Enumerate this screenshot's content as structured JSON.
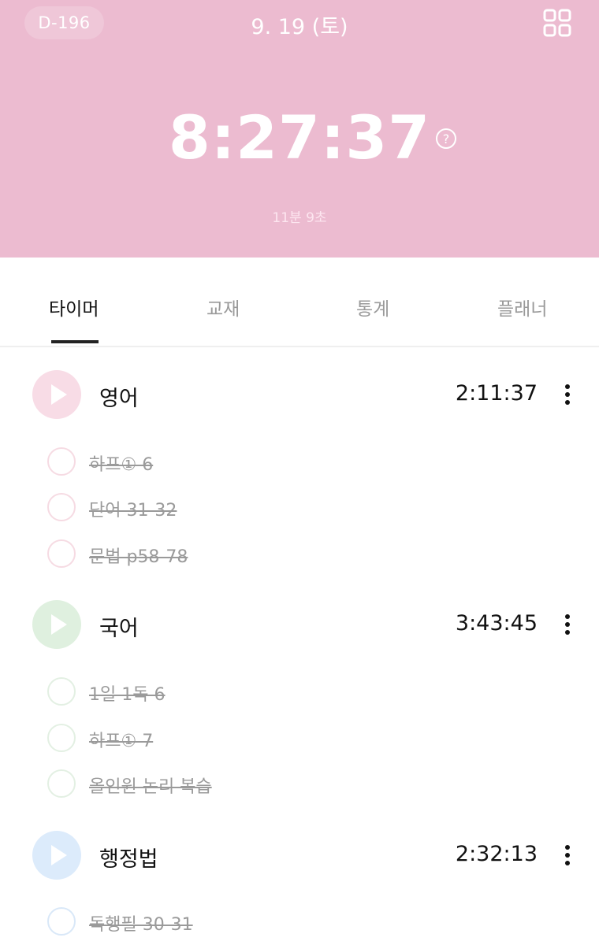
{
  "header": {
    "dday": "D-196",
    "date": "9. 19 (토)",
    "total_time": "8:27:37",
    "sub_time": "11분 9초",
    "background_color": "#ecbbd0"
  },
  "tabs": [
    {
      "label": "타이머",
      "active": true
    },
    {
      "label": "교재",
      "active": false
    },
    {
      "label": "통계",
      "active": false
    },
    {
      "label": "플래너",
      "active": false
    }
  ],
  "subjects": [
    {
      "name": "영어",
      "time": "2:11:37",
      "color": "#f8dce6",
      "check_color": "#f6dbe3",
      "tasks": [
        {
          "label": "하프① 6",
          "done": true
        },
        {
          "label": "단어 31-32",
          "done": true
        },
        {
          "label": "문법 p58-78",
          "done": true
        }
      ]
    },
    {
      "name": "국어",
      "time": "3:43:45",
      "color": "#dff0df",
      "check_color": "#e3f0e3",
      "tasks": [
        {
          "label": "1일 1독 6",
          "done": true
        },
        {
          "label": "하프① 7",
          "done": true
        },
        {
          "label": "올인원 논리 복습",
          "done": true
        }
      ]
    },
    {
      "name": "행정법",
      "time": "2:32:13",
      "color": "#dcebfb",
      "check_color": "#d9e8f8",
      "tasks": [
        {
          "label": "독행필 30-31",
          "done": true
        }
      ]
    }
  ]
}
